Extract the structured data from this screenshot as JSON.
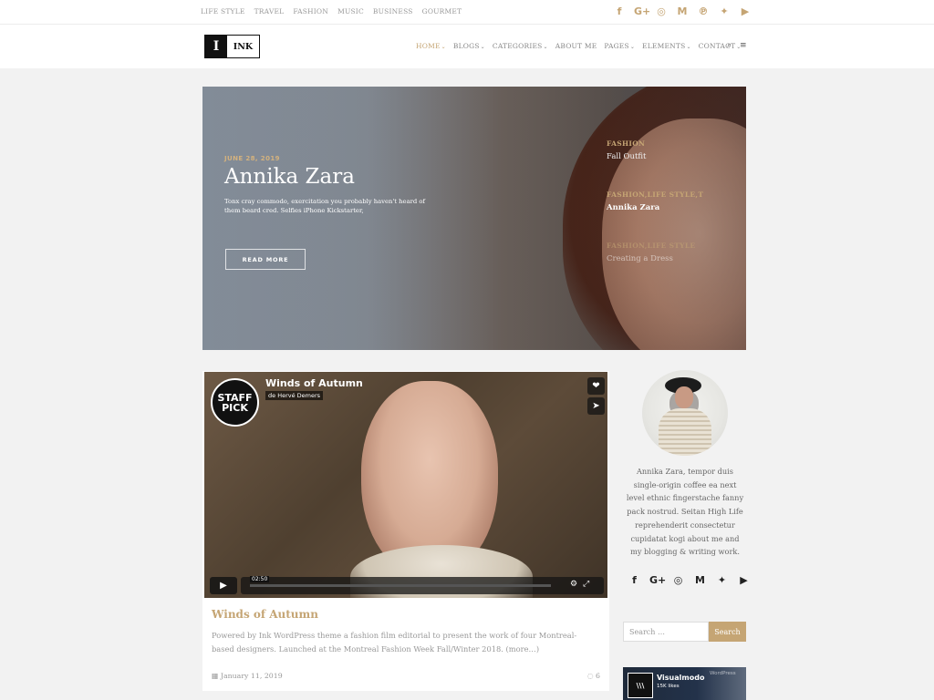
{
  "topbar": {
    "links": [
      "LIFE STYLE",
      "TRAVEL",
      "FASHION",
      "MUSIC",
      "BUSINESS",
      "GOURMET"
    ],
    "social": [
      {
        "icon": "facebook-icon",
        "glyph": "f"
      },
      {
        "icon": "google-plus-icon",
        "glyph": "G+"
      },
      {
        "icon": "instagram-icon",
        "glyph": "◎"
      },
      {
        "icon": "medium-icon",
        "glyph": "M"
      },
      {
        "icon": "pinterest-icon",
        "glyph": "℗"
      },
      {
        "icon": "twitter-icon",
        "glyph": "✦"
      },
      {
        "icon": "youtube-icon",
        "glyph": "▶"
      }
    ]
  },
  "header": {
    "logo_mark": "I",
    "logo_text": "INK",
    "nav": [
      {
        "label": "HOME",
        "dropdown": true,
        "active": true
      },
      {
        "label": "BLOGS",
        "dropdown": true
      },
      {
        "label": "CATEGORIES",
        "dropdown": true
      },
      {
        "label": "ABOUT ME",
        "dropdown": false
      },
      {
        "label": "PAGES",
        "dropdown": true
      },
      {
        "label": "ELEMENTS",
        "dropdown": true
      },
      {
        "label": "CONTACT",
        "dropdown": true
      }
    ],
    "search_icon": "🔍",
    "menu_icon": "≡"
  },
  "hero": {
    "date": "JUNE 28, 2019",
    "title": "Annika Zara",
    "excerpt": "Tonx cray commodo, exercitation you probably haven't heard of them beard cred. Selfies iPhone Kickstarter,",
    "button": "READ MORE",
    "side_posts": [
      {
        "category": "FASHION",
        "title": "Fall Outfit"
      },
      {
        "category": "FASHION,LIFE STYLE,T",
        "title": "Annika Zara"
      },
      {
        "category": "FASHION,LIFE STYLE",
        "title": "Creating a Dress"
      }
    ]
  },
  "post": {
    "video": {
      "badge": "STAFF PICK",
      "title": "Winds of Autumn",
      "author": "de Hervé Demers",
      "time": "02:50",
      "like_icon": "❤",
      "share_icon": "➤",
      "play_icon": "▶",
      "settings_icon": "⚙",
      "fullscreen_icon": "⤢"
    },
    "title": "Winds of Autumn",
    "excerpt": "Powered by Ink WordPress theme a fashion film editorial to present the work of four Montreal-based designers. Launched at the Montreal Fashion Week Fall/Winter 2018. (more…)",
    "date": "January 11, 2019",
    "comments": "6",
    "calendar_icon": "▦",
    "comment_icon": "◌"
  },
  "sidebar": {
    "bio": "Annika Zara, tempor duis single-origin coffee ea next level ethnic fingerstache fanny pack nostrud. Seitan High Life reprehenderit consectetur cupidatat kogi about me and my blogging & writing work.",
    "social": [
      {
        "icon": "facebook-icon",
        "glyph": "f"
      },
      {
        "icon": "google-plus-icon",
        "glyph": "G+"
      },
      {
        "icon": "instagram-icon",
        "glyph": "◎"
      },
      {
        "icon": "medium-icon",
        "glyph": "M"
      },
      {
        "icon": "twitter-icon",
        "glyph": "✦"
      },
      {
        "icon": "youtube-icon",
        "glyph": "▶"
      }
    ],
    "search_placeholder": "Search …",
    "search_button": "Search",
    "fb_widget": {
      "name": "Visualmodo",
      "likes": "15K likes",
      "brand": "WordPress"
    }
  },
  "colors": {
    "accent": "#c5a574",
    "background": "#f2f2f2"
  }
}
